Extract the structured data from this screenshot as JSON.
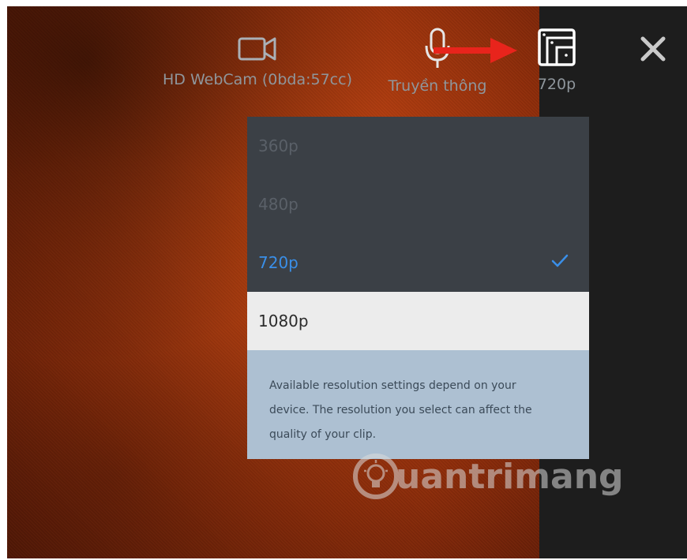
{
  "toolbar": {
    "webcam_label": "HD WebCam (0bda:57cc)",
    "mic_label": "Truyền thông",
    "resolution_label": "720p"
  },
  "resolution_menu": {
    "options": [
      {
        "label": "360p",
        "state": "disabled"
      },
      {
        "label": "480p",
        "state": "disabled"
      },
      {
        "label": "720p",
        "state": "selected"
      },
      {
        "label": "1080p",
        "state": "hovered"
      }
    ],
    "info_text": "Available resolution settings depend on your device. The resolution you select can affect the quality of your clip."
  },
  "watermark": {
    "text": "uantrimang"
  },
  "colors": {
    "selected": "#3a8fe8",
    "arrow": "#e8241c",
    "menu_bg": "#3b4046",
    "info_bg": "#adc0d2"
  },
  "icons": [
    "webcam-icon",
    "microphone-icon",
    "resolution-icon",
    "close-icon",
    "checkmark-icon"
  ]
}
